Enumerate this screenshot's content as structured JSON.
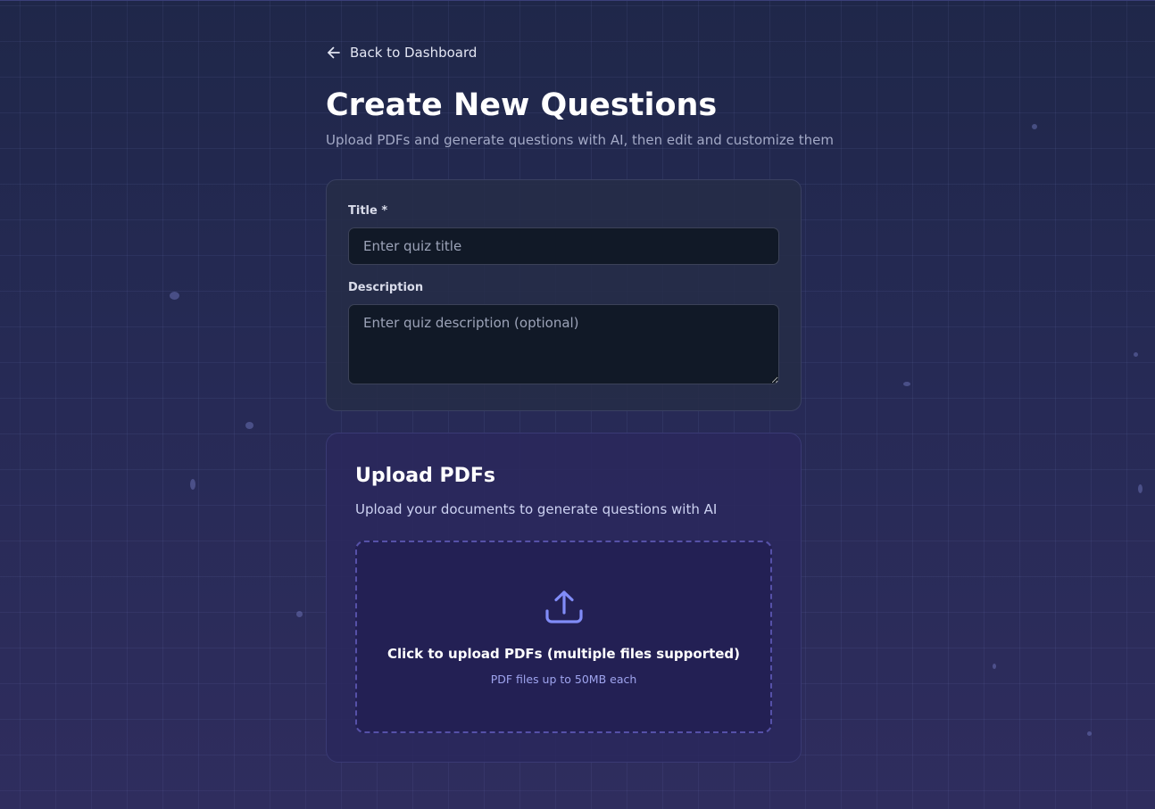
{
  "nav": {
    "back_label": "Back to Dashboard"
  },
  "header": {
    "title": "Create New Questions",
    "subtitle": "Upload PDFs and generate questions with AI, then edit and customize them"
  },
  "form": {
    "title_label": "Title *",
    "title_placeholder": "Enter quiz title",
    "title_value": "",
    "description_label": "Description",
    "description_placeholder": "Enter quiz description (optional)",
    "description_value": ""
  },
  "upload": {
    "title": "Upload PDFs",
    "subtitle": "Upload your documents to generate questions with AI",
    "dropzone_text": "Click to upload PDFs (multiple files supported)",
    "dropzone_hint": "PDF files up to 50MB each",
    "icon": "upload-icon"
  },
  "colors": {
    "background": "#262a55",
    "accent": "#818cf8",
    "dropzone_border": "#5651a8",
    "field_background": "#111927"
  }
}
